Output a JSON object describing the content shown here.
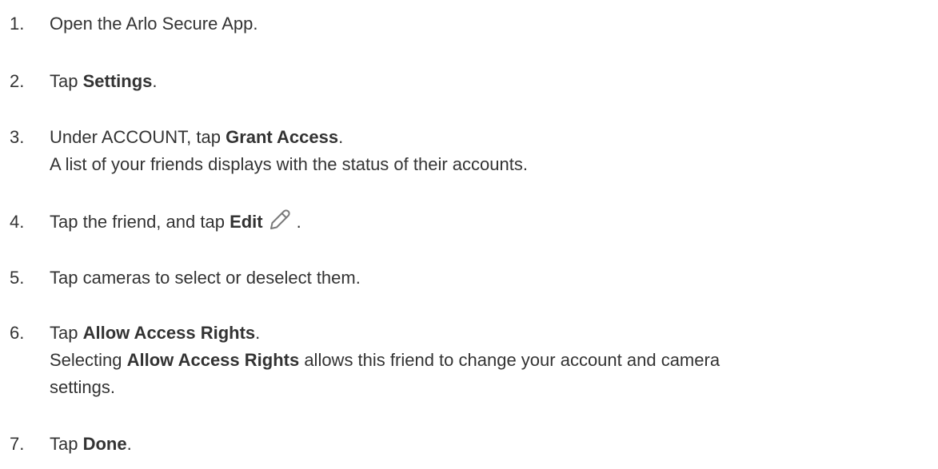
{
  "steps": [
    {
      "number": "1.",
      "text": "Open the Arlo Secure App."
    },
    {
      "number": "2.",
      "pre": "Tap ",
      "bold": "Settings",
      "post": "."
    },
    {
      "number": "3.",
      "pre": "Under ACCOUNT, tap ",
      "bold": "Grant Access",
      "post": ".",
      "note": "A list of your friends displays with the status of their accounts."
    },
    {
      "number": "4.",
      "pre": "Tap the friend, and tap ",
      "bold": "Edit",
      "post": ".",
      "icon": "pencil-edit-icon"
    },
    {
      "number": "5.",
      "text": "Tap cameras to select or deselect them."
    },
    {
      "number": "6.",
      "pre": "Tap ",
      "bold": "Allow Access Rights",
      "post": ".",
      "note_pre": "Selecting ",
      "note_bold": "Allow Access Rights",
      "note_post_line1": " allows this friend to change your account and camera",
      "note_post_line2": "settings."
    },
    {
      "number": "7.",
      "pre": "Tap ",
      "bold": "Done",
      "post": "."
    }
  ]
}
